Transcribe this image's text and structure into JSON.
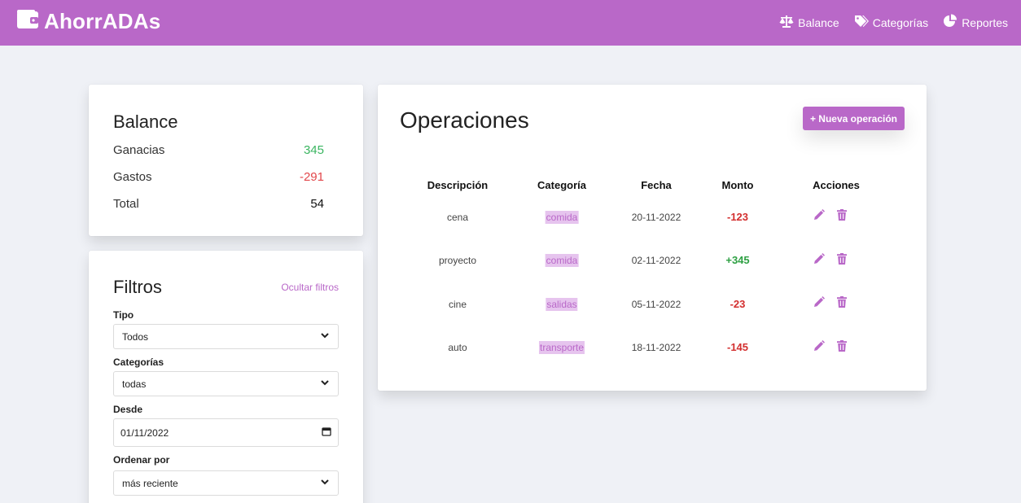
{
  "app": {
    "name": "AhorrADAs",
    "icon": "wallet-icon"
  },
  "nav": [
    {
      "label": "Balance",
      "icon": "balance-scale-icon"
    },
    {
      "label": "Categorías",
      "icon": "tags-icon"
    },
    {
      "label": "Reportes",
      "icon": "pie-chart-icon"
    }
  ],
  "balance": {
    "title": "Balance",
    "rows": [
      {
        "label": "Ganacias",
        "value": "345",
        "color": "#3ab560"
      },
      {
        "label": "Gastos",
        "value": "-291",
        "color": "#e2474b"
      },
      {
        "label": "Total",
        "value": "54",
        "color": "#111111"
      }
    ]
  },
  "filters": {
    "title": "Filtros",
    "hide_label": "Ocultar filtros",
    "tipo": {
      "label": "Tipo",
      "value": "Todos"
    },
    "categorias": {
      "label": "Categorías",
      "value": "todas"
    },
    "desde": {
      "label": "Desde",
      "value": "01/11/2022"
    },
    "ordenar": {
      "label": "Ordenar por",
      "value": "más reciente"
    }
  },
  "operations": {
    "title": "Operaciones",
    "new_button": "+ Nueva operación",
    "columns": [
      "Descripción",
      "Categoría",
      "Fecha",
      "Monto",
      "Acciones"
    ],
    "rows": [
      {
        "descripcion": "cena",
        "categoria": "comida",
        "fecha": "20-11-2022",
        "monto": "-123"
      },
      {
        "descripcion": "proyecto",
        "categoria": "comida",
        "fecha": "02-11-2022",
        "monto": "+345"
      },
      {
        "descripcion": "cine",
        "categoria": "salidas",
        "fecha": "05-11-2022",
        "monto": "-23"
      },
      {
        "descripcion": "auto",
        "categoria": "transporte",
        "fecha": "18-11-2022",
        "monto": "-145"
      }
    ]
  },
  "colors": {
    "brand": "#b968c8",
    "tag_bg": "#e6c4ee",
    "positive": "#2ea043",
    "negative": "#d32f2f",
    "background": "#eff1f6"
  }
}
